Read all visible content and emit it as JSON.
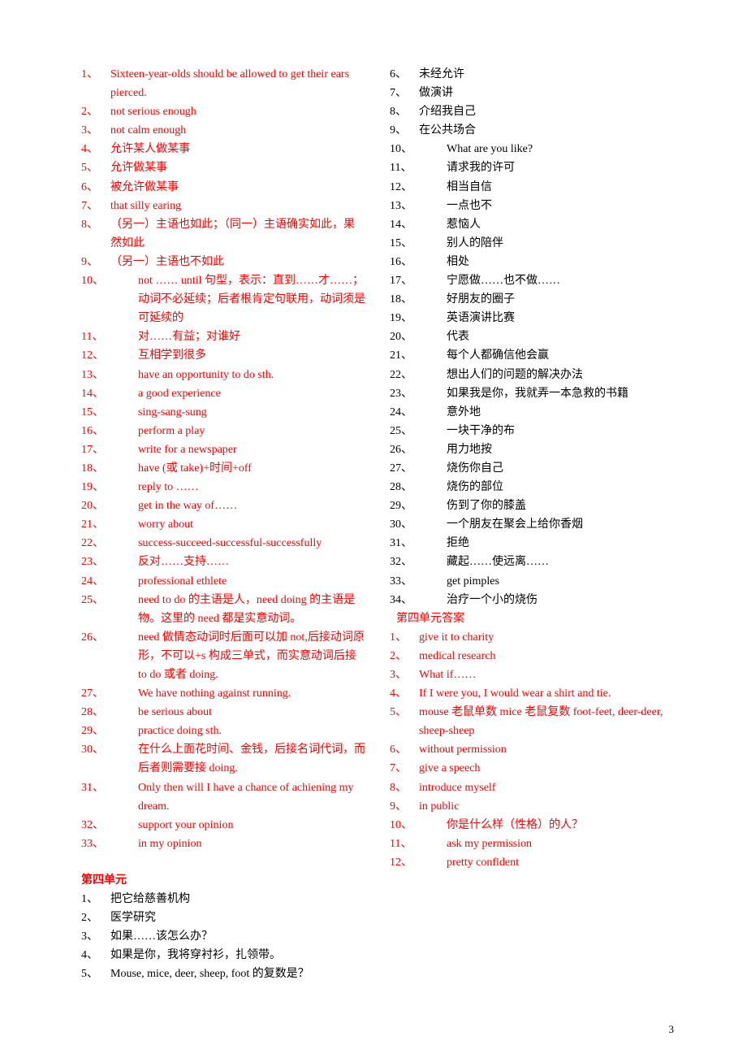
{
  "pagenum": "3",
  "items": [
    {
      "n": "1、",
      "t": "Sixteen-year-olds should be allowed to get their ears pierced.",
      "red": true,
      "wide": false
    },
    {
      "n": "2、",
      "t": "not serious enough",
      "red": true,
      "wide": false
    },
    {
      "n": "3、",
      "t": "not calm enough",
      "red": true,
      "wide": false
    },
    {
      "n": "4、",
      "t": "允许某人做某事",
      "red": true,
      "wide": false
    },
    {
      "n": "5、",
      "t": "允许做某事",
      "red": true,
      "wide": false
    },
    {
      "n": "6、",
      "t": "被允许做某事",
      "red": true,
      "wide": false
    },
    {
      "n": "7、",
      "t": "that silly earing",
      "red": true,
      "wide": false
    },
    {
      "n": "8、",
      "t": "（另一）主语也如此；（同一）主语确实如此，果然如此",
      "red": true,
      "wide": false
    },
    {
      "n": "9、",
      "t": "（另一）主语也不如此",
      "red": true,
      "wide": false
    },
    {
      "n": "10、",
      "t": "not …… until 句型，表示：直到……才……；动词不必延续；后者根肯定句联用，动词须是可延续的",
      "red": true,
      "wide": true
    },
    {
      "n": "11、",
      "t": "对……有益；对谁好",
      "red": true,
      "wide": true
    },
    {
      "n": "12、",
      "t": "互相学到很多",
      "red": true,
      "wide": true
    },
    {
      "n": "13、",
      "t": "have an opportunity to do sth.",
      "red": true,
      "wide": true
    },
    {
      "n": "14、",
      "t": "a good experience",
      "red": true,
      "wide": true
    },
    {
      "n": "15、",
      "t": "sing-sang-sung",
      "red": true,
      "wide": true
    },
    {
      "n": "16、",
      "t": "perform a play",
      "red": true,
      "wide": true
    },
    {
      "n": "17、",
      "t": "write for a newspaper",
      "red": true,
      "wide": true
    },
    {
      "n": "18、",
      "t": "have (或 take)+时间+off",
      "red": true,
      "wide": true
    },
    {
      "n": "19、",
      "t": "reply to ……",
      "red": true,
      "wide": true
    },
    {
      "n": "20、",
      "t": "get in the way of……",
      "red": true,
      "wide": true
    },
    {
      "n": "21、",
      "t": "worry about",
      "red": true,
      "wide": true
    },
    {
      "n": "22、",
      "t": "success-succeed-successful-successfully",
      "red": true,
      "wide": true
    },
    {
      "n": "23、",
      "t": "反对……支持……",
      "red": true,
      "wide": true
    },
    {
      "n": "24、",
      "t": "professional ethlete",
      "red": true,
      "wide": true
    },
    {
      "n": "25、",
      "t": "need to do 的主语是人，need doing 的主语是物。这里的 need 都是实意动词。",
      "red": true,
      "wide": true
    },
    {
      "n": "26、",
      "t": "need 做情态动词时后面可以加 not,后接动词原形，不可以+s 构成三单式，而实意动词后接 to do 或者 doing.",
      "red": true,
      "wide": true
    },
    {
      "n": "27、",
      "t": "We have nothing against running.",
      "red": true,
      "wide": true
    },
    {
      "n": "28、",
      "t": "be serious about",
      "red": true,
      "wide": true
    },
    {
      "n": "29、",
      "t": "practice doing sth.",
      "red": true,
      "wide": true
    },
    {
      "n": "30、",
      "t": "在什么上面花时间、金钱，后接名词代词，而后者则需要接 doing.",
      "red": true,
      "wide": true
    },
    {
      "n": "31、",
      "t": "Only then will I have a chance of achiening my dream.",
      "red": true,
      "wide": true
    },
    {
      "n": "32、",
      "t": "support your opinion",
      "red": true,
      "wide": true
    },
    {
      "n": "33、",
      "t": "in my opinion",
      "red": true,
      "wide": true
    },
    {
      "n": "",
      "t": "",
      "red": false,
      "wide": false,
      "blank": true
    },
    {
      "n": "",
      "t": "第四单元",
      "red": true,
      "wide": false,
      "heading": true
    },
    {
      "n": "1、",
      "t": "把它给慈善机构",
      "red": false,
      "wide": false
    },
    {
      "n": "2、",
      "t": "医学研究",
      "red": false,
      "wide": false
    },
    {
      "n": "3、",
      "t": "如果……该怎么办？",
      "red": false,
      "wide": false
    },
    {
      "n": "4、",
      "t": "如果是你，我将穿衬衫，扎领带。",
      "red": false,
      "wide": false
    },
    {
      "n": "5、",
      "t": "Mouse, mice, deer, sheep, foot 的复数是？",
      "red": false,
      "wide": false
    },
    {
      "n": "6、",
      "t": "未经允许",
      "red": false,
      "wide": false
    },
    {
      "n": "7、",
      "t": "做演讲",
      "red": false,
      "wide": false
    },
    {
      "n": "8、",
      "t": "介绍我自己",
      "red": false,
      "wide": false
    },
    {
      "n": "9、",
      "t": "在公共场合",
      "red": false,
      "wide": false
    },
    {
      "n": "10、",
      "t": "What are you like?",
      "red": false,
      "wide": true
    },
    {
      "n": "11、",
      "t": "请求我的许可",
      "red": false,
      "wide": true
    },
    {
      "n": "12、",
      "t": "相当自信",
      "red": false,
      "wide": true
    },
    {
      "n": "13、",
      "t": "一点也不",
      "red": false,
      "wide": true
    },
    {
      "n": "14、",
      "t": "惹恼人",
      "red": false,
      "wide": true
    },
    {
      "n": "15、",
      "t": "别人的陪伴",
      "red": false,
      "wide": true
    },
    {
      "n": "16、",
      "t": "相处",
      "red": false,
      "wide": true
    },
    {
      "n": "17、",
      "t": "宁愿做……也不做……",
      "red": false,
      "wide": true
    },
    {
      "n": "18、",
      "t": "好朋友的圈子",
      "red": false,
      "wide": true
    },
    {
      "n": "19、",
      "t": "英语演讲比赛",
      "red": false,
      "wide": true
    },
    {
      "n": "20、",
      "t": "代表",
      "red": false,
      "wide": true
    },
    {
      "n": "21、",
      "t": "每个人都确信他会赢",
      "red": false,
      "wide": true
    },
    {
      "n": "22、",
      "t": "想出人们的问题的解决办法",
      "red": false,
      "wide": true
    },
    {
      "n": "23、",
      "t": "如果我是你，我就弄一本急救的书籍",
      "red": false,
      "wide": true
    },
    {
      "n": "24、",
      "t": "意外地",
      "red": false,
      "wide": true
    },
    {
      "n": "25、",
      "t": "一块干净的布",
      "red": false,
      "wide": true
    },
    {
      "n": "26、",
      "t": "用力地按",
      "red": false,
      "wide": true
    },
    {
      "n": "27、",
      "t": "烧伤你自己",
      "red": false,
      "wide": true
    },
    {
      "n": "28、",
      "t": "烧伤的部位",
      "red": false,
      "wide": true
    },
    {
      "n": "29、",
      "t": "伤到了你的膝盖",
      "red": false,
      "wide": true
    },
    {
      "n": "30、",
      "t": "一个朋友在聚会上给你香烟",
      "red": false,
      "wide": true
    },
    {
      "n": "31、",
      "t": "拒绝",
      "red": false,
      "wide": true
    },
    {
      "n": "32、",
      "t": "藏起……使远离……",
      "red": false,
      "wide": true
    },
    {
      "n": "33、",
      "t": "get pimples",
      "red": false,
      "wide": true
    },
    {
      "n": "34、",
      "t": "治疗一个小的烧伤",
      "red": false,
      "wide": true
    },
    {
      "n": "",
      "t": "第四单元答案",
      "red": true,
      "wide": false,
      "indent": true
    },
    {
      "n": "1、",
      "t": "give it to charity",
      "red": true,
      "wide": false
    },
    {
      "n": "2、",
      "t": "medical research",
      "red": true,
      "wide": false
    },
    {
      "n": "3、",
      "t": "What if……",
      "red": true,
      "wide": false
    },
    {
      "n": "4、",
      "t": "If I were you, I would wear a shirt and tie.",
      "red": true,
      "wide": false
    },
    {
      "n": "5、",
      "t": "mouse 老鼠单数 mice 老鼠复数 foot-feet, deer-deer, sheep-sheep",
      "red": true,
      "wide": false
    },
    {
      "n": "6、",
      "t": "without permission",
      "red": true,
      "wide": false
    },
    {
      "n": "7、",
      "t": "give a speech",
      "red": true,
      "wide": false
    },
    {
      "n": "8、",
      "t": "introduce myself",
      "red": true,
      "wide": false
    },
    {
      "n": "9、",
      "t": "in public",
      "red": true,
      "wide": false
    },
    {
      "n": "10、",
      "t": "你是什么样（性格）的人？",
      "red": true,
      "wide": true
    },
    {
      "n": "11、",
      "t": "ask my permission",
      "red": true,
      "wide": true
    },
    {
      "n": "12、",
      "t": "pretty confident",
      "red": true,
      "wide": true
    }
  ]
}
